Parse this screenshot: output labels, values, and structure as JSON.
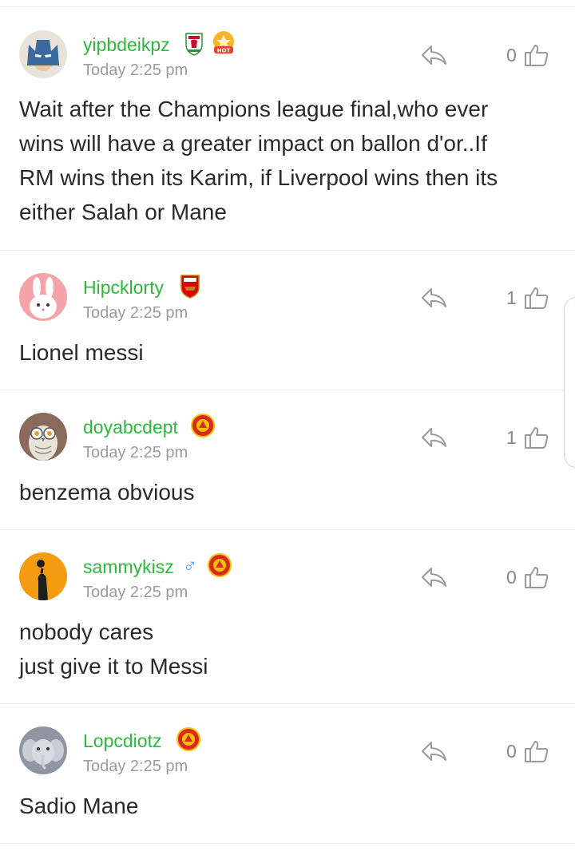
{
  "comments": [
    {
      "username": "yipbdeikpz",
      "time": "Today 2:25 pm",
      "likes": "0",
      "lines": [
        "Wait after the Champions league final,who ever",
        "wins will have a greater impact on ballon d'or..If",
        "RM wins then its Karim, if Liverpool wins then its",
        "either Salah or Mane"
      ],
      "badges": [
        "liverpool-crest",
        "hot-badge"
      ],
      "avatar": "batman-avatar"
    },
    {
      "username": "Hipcklorty",
      "time": "Today 2:25 pm",
      "likes": "1",
      "lines": [
        "Lionel messi"
      ],
      "badges": [
        "arsenal-crest"
      ],
      "avatar": "rabbit-avatar"
    },
    {
      "username": "doyabcdept",
      "time": "Today 2:25 pm",
      "likes": "1",
      "lines": [
        "benzema obvious"
      ],
      "badges": [
        "man-utd-crest"
      ],
      "avatar": "owl-avatar"
    },
    {
      "username": "sammykisz",
      "gender": "♂",
      "time": "Today 2:25 pm",
      "likes": "0",
      "lines": [
        "nobody cares",
        "just give it to Messi"
      ],
      "badges": [
        "man-utd-crest"
      ],
      "avatar": "basketball-avatar"
    },
    {
      "username": "Lopcdiotz",
      "time": "Today 2:25 pm",
      "likes": "0",
      "lines": [
        "Sadio Mane"
      ],
      "badges": [
        "man-utd-crest"
      ],
      "avatar": "elephant-avatar"
    }
  ],
  "colors": {
    "username": "#2db83d",
    "time": "#9b9b9b",
    "text": "#2a2a2a",
    "icon": "#9a9a9a"
  }
}
